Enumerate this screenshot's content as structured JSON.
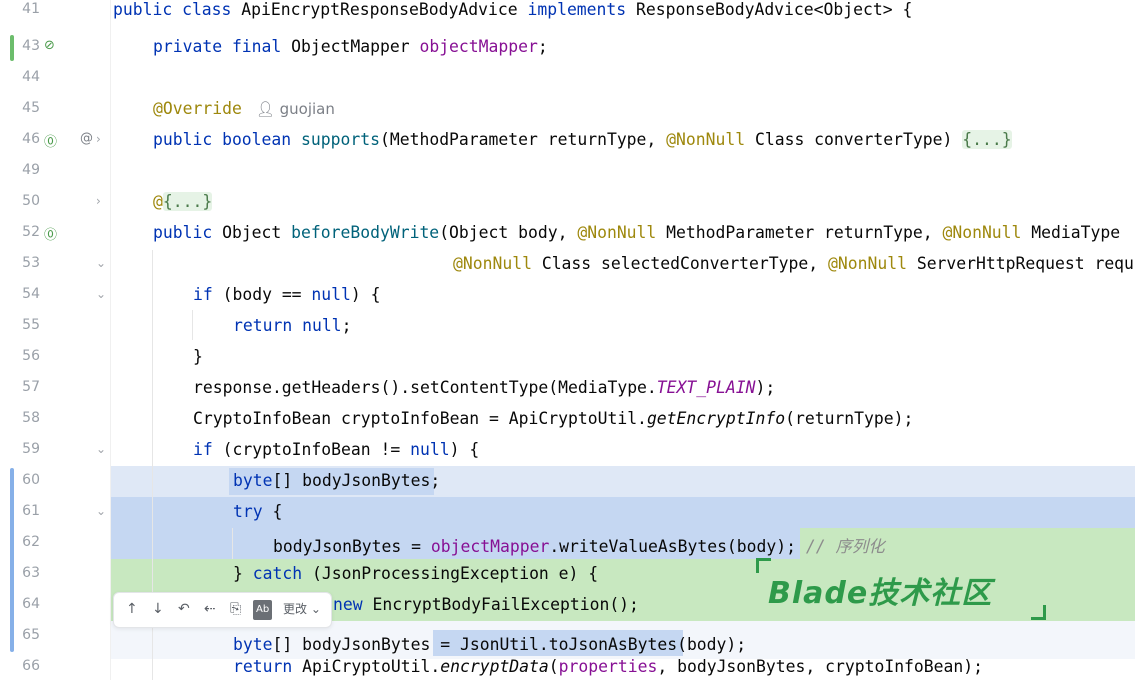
{
  "line_numbers": [
    "41",
    "43",
    "44",
    "45",
    "46",
    "49",
    "50",
    "52",
    "53",
    "54",
    "55",
    "56",
    "57",
    "58",
    "59",
    "60",
    "61",
    "62",
    "63",
    "64",
    "65",
    "66"
  ],
  "colors": {
    "selection_blue": "#c5d7f2",
    "added_green": "#c8e8c0",
    "modified_bar": "#86b0e8",
    "added_bar": "#6cbd6c",
    "watermark": "#2e9a4a"
  },
  "code": {
    "l41": {
      "kw1": "public class ",
      "name": "ApiEncryptResponseBodyAdvice ",
      "kw2": "implements ",
      "rest": "ResponseBodyAdvice<Object> {"
    },
    "l43": {
      "kw": "private final ",
      "type": "ObjectMapper ",
      "field": "objectMapper",
      "end": ";"
    },
    "l45": {
      "ann": "@Override",
      "author": "guojian"
    },
    "l46": {
      "kw": "public boolean ",
      "fn": "supports",
      "p1": "(MethodParameter returnType, ",
      "ann": "@NonNull",
      "p2": " Class converterType) ",
      "fold": "{...}"
    },
    "l50": {
      "ann": "@",
      "fold": "{...}"
    },
    "l52": {
      "kw": "public ",
      "t": "Object ",
      "fn": "beforeBodyWrite",
      "p1": "(Object body, ",
      "a1": "@NonNull",
      "p2": " MethodParameter returnType, ",
      "a2": "@NonNull",
      "p3": " MediaType"
    },
    "l53": {
      "a1": "@NonNull",
      "p1": " Class selectedConverterType, ",
      "a2": "@NonNull",
      "p2": " ServerHttpRequest requ"
    },
    "l54": {
      "kw": "if ",
      "p1": "(body == ",
      "kw2": "null",
      "p2": ") {"
    },
    "l55": {
      "kw": "return ",
      "kw2": "null",
      "end": ";"
    },
    "l56": {
      "t": "}"
    },
    "l57": {
      "p1": "response.getHeaders().setContentType(MediaType.",
      "st": "TEXT_PLAIN",
      "end": ");"
    },
    "l58": {
      "p1": "CryptoInfoBean cryptoInfoBean = ApiCryptoUtil.",
      "it": "getEncryptInfo",
      "end": "(returnType);"
    },
    "l59": {
      "kw": "if ",
      "p1": "(cryptoInfoBean != ",
      "kw2": "null",
      "end": ") {"
    },
    "l60": {
      "kw": "byte",
      "p1": "[] bodyJsonBytes;"
    },
    "l61": {
      "kw": "try ",
      "p1": "{"
    },
    "l62": {
      "p1": "bodyJsonBytes = ",
      "fld": "objectMapper",
      "p2": ".writeValueAsBytes(body); ",
      "cm": "// 序列化"
    },
    "l63": {
      "p1": "} ",
      "kw": "catch ",
      "p2": "(JsonProcessingException e) {"
    },
    "l64": {
      "kw": "new ",
      "p1": "EncryptBodyFailException();"
    },
    "l65": {
      "kw": "byte",
      "p1": "[] bodyJsonBytes = JsonUtil.toJsonAsBytes(body);"
    },
    "l66": {
      "kw": "return ",
      "p1": "ApiCryptoUtil.",
      "it": "encryptData",
      "p2": "(",
      "fld": "properties",
      "p3": ", bodyJsonBytes, cryptoInfoBean);"
    }
  },
  "toolbar": {
    "up": "↑",
    "down": "↓",
    "undo": "↶",
    "merge": "⇠",
    "copy": "⎘",
    "ab": "Ab",
    "more_label": "更改"
  },
  "watermark": {
    "text": "Blade技术社区"
  }
}
